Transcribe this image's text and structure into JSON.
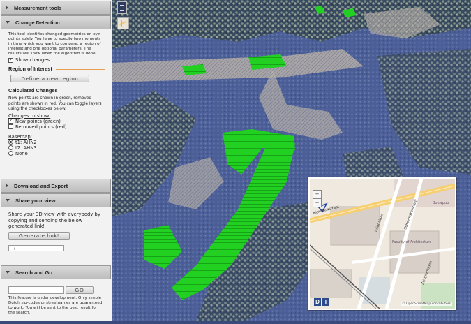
{
  "sidebar": {
    "measurement": {
      "label": "Measurement tools"
    },
    "change_detection": {
      "label": "Change Detection",
      "intro": "This tool identifies changed geometries on xyz-points solely. You have to specify two moments in time which you want to compare, a region of interest and one optional parameters. The results will show when the algorithm is done.",
      "show_changes": "Show changes",
      "roi_title": "Region of Interest",
      "define_region_button": "Define a new region",
      "calc_title": "Calculated Changes",
      "calc_text": "New points are shown in green, removed points are shown in red. You can toggle layers using the checkboxes below.",
      "changes_to_show": "Changes to show:",
      "new_points": "New points (green)",
      "removed_points": "Removed points (red)",
      "basemap_label": "Basemap:",
      "basemaps": [
        "t1: AHN2",
        "t2: AHN3",
        "None"
      ]
    },
    "download": {
      "label": "Download and Export"
    },
    "share": {
      "label": "Share your view",
      "text": "Share your 3D view with everybody by copying and sending the below generated link!",
      "generate_button": "Generate link!",
      "link_value": "../"
    },
    "search": {
      "label": "Search and Go",
      "go_button": "GO",
      "note": "This feature is under development. Only simple Dutch zip-codes or streetnames are guaranteed to work. You will be sent to the best result for the search."
    }
  },
  "minimap": {
    "zoom_in": "+",
    "zoom_out": "−",
    "d_button": "D",
    "t_button": "T",
    "labels": [
      "Mijnbouwstraat",
      "Julianalaan",
      "Faculty of Architecture",
      "Bouwpub",
      "Schoemakerstraat",
      "Zuidplantsoen"
    ],
    "attribution": "© OpenStreetMap contributors"
  },
  "colors": {
    "new_points": "#27d227",
    "point_cloud": "#4a5e96",
    "accent_line": "#e8a050"
  }
}
